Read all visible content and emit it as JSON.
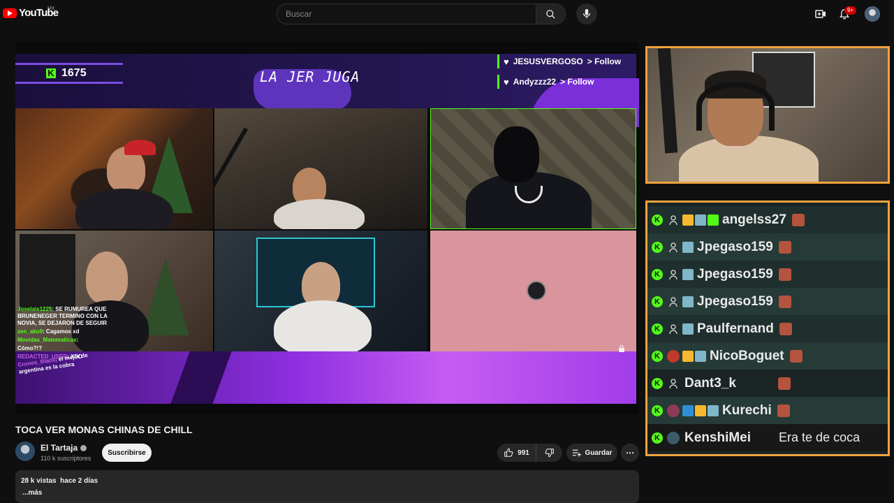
{
  "masthead": {
    "logo_text": "YouTube",
    "region": "MX",
    "search_placeholder": "Buscar",
    "notifications_badge": "9+",
    "icons": [
      "search-icon",
      "mic-icon",
      "create-icon",
      "bell-icon",
      "avatar"
    ]
  },
  "stream": {
    "kick_count": "1675",
    "title_art": "LA JER JUGA",
    "follows": [
      {
        "user": "JESUSVERGOSO",
        "action": "> Follow"
      },
      {
        "user": "Andyzzz22",
        "action": "> Follow"
      }
    ],
    "overlay_chat": [
      {
        "user": "Joselais1225",
        "text": ": SE RUMUREA QUE BRUNENEGER TERMINO CON LA NOVIA, SE DEJARON DE SEGUIR"
      },
      {
        "user": "zen_aku9",
        "text": ": Cagamos xd"
      },
      {
        "user": "Movidas_Matematicas",
        "text": ":"
      },
      {
        "user": "",
        "text": "Cómo?!?"
      },
      {
        "user": "REDACTED_USER",
        "text": ": XDD"
      },
      {
        "user": "Cronos_Black",
        "text": ": el mejor de argentina es la cobra"
      }
    ]
  },
  "chat_panel": {
    "rows": [
      {
        "name": "angelss27",
        "badges": [
          "crown",
          "sub",
          "gift"
        ],
        "message": ""
      },
      {
        "name": "Jpegaso159",
        "badges": [
          "sub"
        ],
        "message": ""
      },
      {
        "name": "Jpegaso159",
        "badges": [
          "sub"
        ],
        "message": ""
      },
      {
        "name": "Jpegaso159",
        "badges": [
          "sub"
        ],
        "message": ""
      },
      {
        "name": "Paulfernand",
        "badges": [
          "sub"
        ],
        "message": ""
      },
      {
        "name": "NicoBoguet",
        "badges": [
          "crown",
          "sub"
        ],
        "message": ""
      },
      {
        "name": "Dant3_k",
        "badges": [],
        "message": ""
      },
      {
        "name": "Kurechi",
        "badges": [
          "blue",
          "crown",
          "sub"
        ],
        "message": ""
      },
      {
        "name": "KenshiMei",
        "badges": [],
        "message": "Era te de coca"
      }
    ]
  },
  "video": {
    "title": "TOCA VER MONAS CHINAS DE CHILL",
    "channel_name": "El Tartaja",
    "subscribers": "110 k suscriptores",
    "subscribe_label": "Suscribirse",
    "likes": "991",
    "save_label": "Guardar",
    "views": "28 k vistas",
    "age": "hace 2 días",
    "more_label": "...más"
  },
  "colors": {
    "accent_kick": "#53fc18",
    "frame_orange": "#f0a33e",
    "youtube_red": "#ff0000",
    "overlay_purple": "#8d2fe0"
  }
}
